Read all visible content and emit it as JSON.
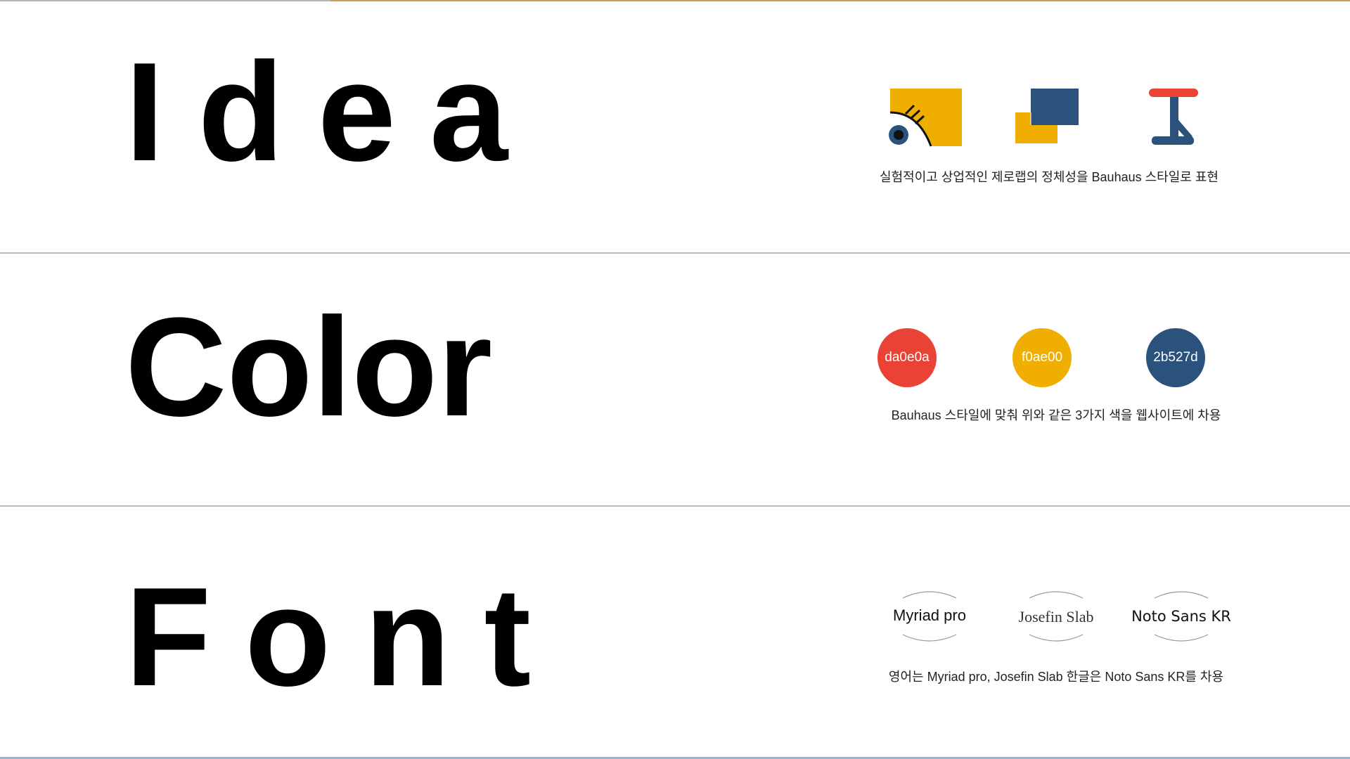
{
  "sections": {
    "idea": {
      "title": "Idea",
      "caption": "실험적이고 상업적인 제로랩의 정체성을 Bauhaus 스타일로 표현",
      "icons": [
        "eye-square-icon",
        "overlapping-squares-icon",
        "i-beam-figure-icon"
      ]
    },
    "color": {
      "title": "Color",
      "caption": "Bauhaus 스타일에 맞춰 위와 같은 3가지 색을 웹사이트에 차용",
      "swatches": [
        {
          "label": "da0e0a",
          "color": "#ea4335"
        },
        {
          "label": "f0ae00",
          "color": "#f0ae00"
        },
        {
          "label": "2b527d",
          "color": "#2b527d"
        }
      ]
    },
    "font": {
      "title": "Font",
      "caption": "영어는 Myriad pro,  Josefin Slab   한글은 Noto Sans KR를 차용",
      "fonts": [
        "Myriad pro",
        "Josefin Slab",
        "Noto Sans KR"
      ]
    }
  },
  "colors": {
    "red": "#ea4335",
    "yellow": "#f0ae00",
    "blue": "#2b527d"
  }
}
